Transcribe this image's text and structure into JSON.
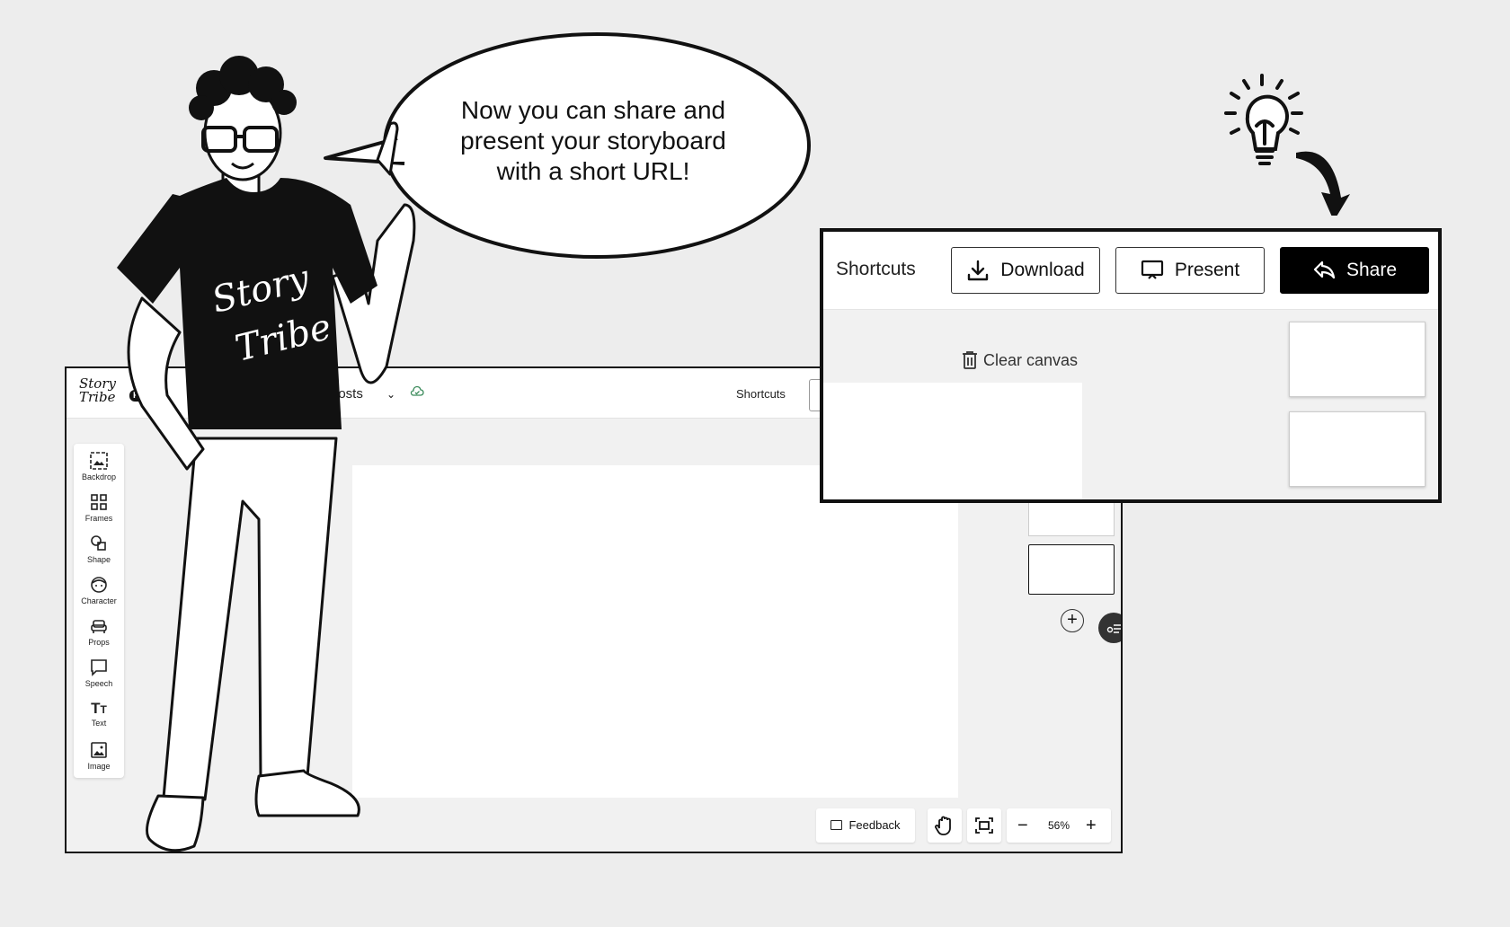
{
  "speech": {
    "line1": "Now you can share and",
    "line2": "present your storyboard",
    "line3": "with a short URL!"
  },
  "header": {
    "logo_text": "Story Tribe",
    "pro_badge": "PRO",
    "project_title": "posts",
    "shortcuts_label": "Shortcuts"
  },
  "toolbar": {
    "items": [
      {
        "label": "Backdrop",
        "icon": "backdrop-icon"
      },
      {
        "label": "Frames",
        "icon": "frames-icon"
      },
      {
        "label": "Shape",
        "icon": "shape-icon"
      },
      {
        "label": "Character",
        "icon": "character-icon"
      },
      {
        "label": "Props",
        "icon": "props-icon"
      },
      {
        "label": "Speech",
        "icon": "speech-icon"
      },
      {
        "label": "Text",
        "icon": "text-icon"
      },
      {
        "label": "Image",
        "icon": "image-icon"
      }
    ]
  },
  "bottom_bar": {
    "feedback_label": "Feedback",
    "zoom_level": "56%"
  },
  "callout": {
    "shortcuts_label": "Shortcuts",
    "download_label": "Download",
    "present_label": "Present",
    "share_label": "Share",
    "clear_canvas_label": "Clear canvas"
  },
  "tshirt": {
    "line1": "Story",
    "line2": "Tribe"
  }
}
